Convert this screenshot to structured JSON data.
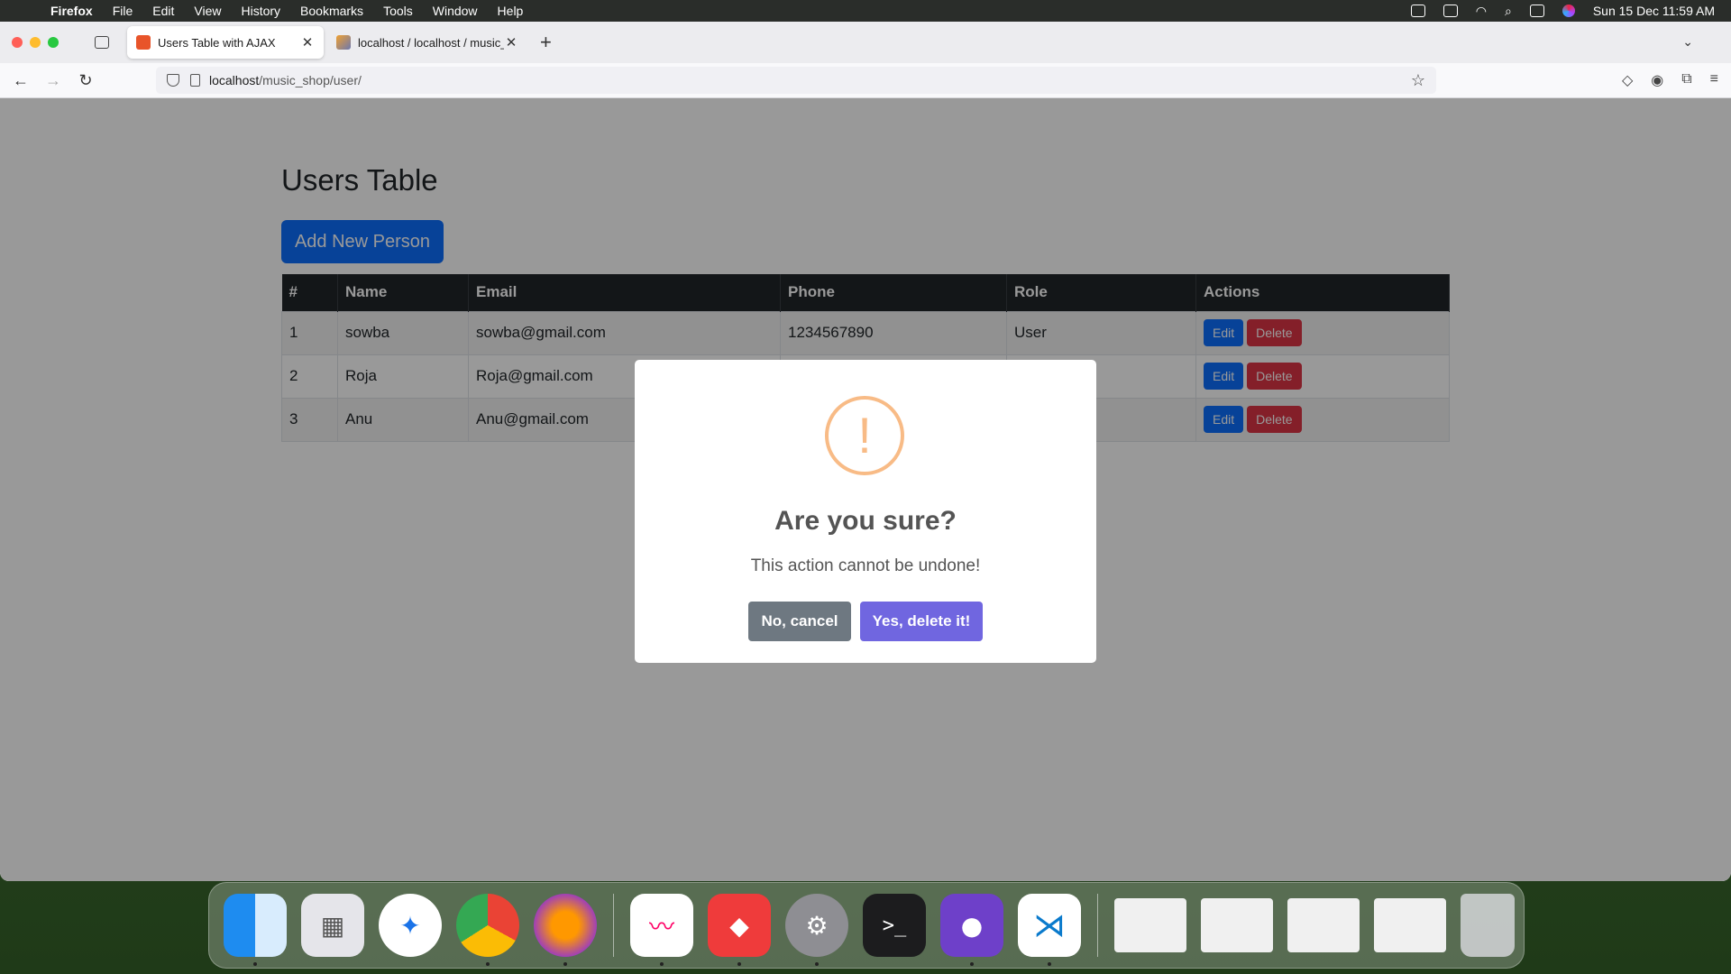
{
  "menubar": {
    "app": "Firefox",
    "items": [
      "File",
      "Edit",
      "View",
      "History",
      "Bookmarks",
      "Tools",
      "Window",
      "Help"
    ],
    "datetime": "Sun 15 Dec  11:59 AM"
  },
  "browser": {
    "tabs": [
      {
        "title": "Users Table with AJAX",
        "active": true
      },
      {
        "title": "localhost / localhost / music_sh",
        "active": false
      }
    ],
    "url_host": "localhost",
    "url_path": "/music_shop/user/"
  },
  "page": {
    "title": "Users Table",
    "add_button": "Add New Person",
    "columns": [
      "#",
      "Name",
      "Email",
      "Phone",
      "Role",
      "Actions"
    ],
    "rows": [
      {
        "id": "1",
        "name": "sowba",
        "email": "sowba@gmail.com",
        "phone": "1234567890",
        "role": "User"
      },
      {
        "id": "2",
        "name": "Roja",
        "email": "Roja@gmail.com",
        "phone": "",
        "role": ""
      },
      {
        "id": "3",
        "name": "Anu",
        "email": "Anu@gmail.com",
        "phone": "",
        "role": ""
      }
    ],
    "edit_label": "Edit",
    "delete_label": "Delete"
  },
  "modal": {
    "icon_glyph": "!",
    "title": "Are you sure?",
    "text": "This action cannot be undone!",
    "cancel_label": "No, cancel",
    "confirm_label": "Yes, delete it!",
    "confirm_color": "#7066e0",
    "cancel_color": "#6e7881",
    "icon_color": "#f8bb86"
  },
  "dock": {
    "apps": [
      "finder",
      "launchpad",
      "safari",
      "chrome",
      "firefox",
      "freeform",
      "anydesk",
      "system-settings",
      "terminal",
      "github-desktop",
      "vscode"
    ],
    "terminal_glyph": ">_"
  }
}
